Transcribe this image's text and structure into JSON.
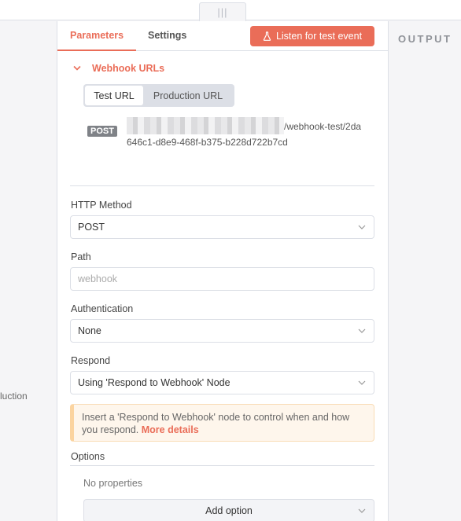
{
  "drag_handle": {
    "glyph": "|||"
  },
  "canvas": {
    "partial_label": "luction"
  },
  "output": {
    "title": "OUTPUT"
  },
  "tabs": [
    {
      "label": "Parameters",
      "active": true
    },
    {
      "label": "Settings",
      "active": false
    }
  ],
  "listen_button": {
    "label": "Listen for test event",
    "icon": "flask-icon"
  },
  "webhook_urls": {
    "section_title": "Webhook URLs",
    "toggle": {
      "selected": "Test URL",
      "other": "Production URL"
    },
    "method_badge": "POST",
    "url_path_line1": "/webhook-test/2da",
    "url_path_line2": "646c1-d8e9-468f-b375-b228d722b7cd"
  },
  "fields": {
    "http_method": {
      "label": "HTTP Method",
      "value": "POST"
    },
    "path": {
      "label": "Path",
      "placeholder": "webhook"
    },
    "authentication": {
      "label": "Authentication",
      "value": "None"
    },
    "respond": {
      "label": "Respond",
      "value": "Using 'Respond to Webhook' Node"
    }
  },
  "notice": {
    "text": "Insert a 'Respond to Webhook' node to control when and how you respond.",
    "link": "More details"
  },
  "options": {
    "label": "Options",
    "empty_text": "No properties",
    "add_button": "Add option"
  },
  "colors": {
    "accent": "#ea6d58",
    "notice_bg": "#fef6ec",
    "border": "#dcdfe6"
  }
}
